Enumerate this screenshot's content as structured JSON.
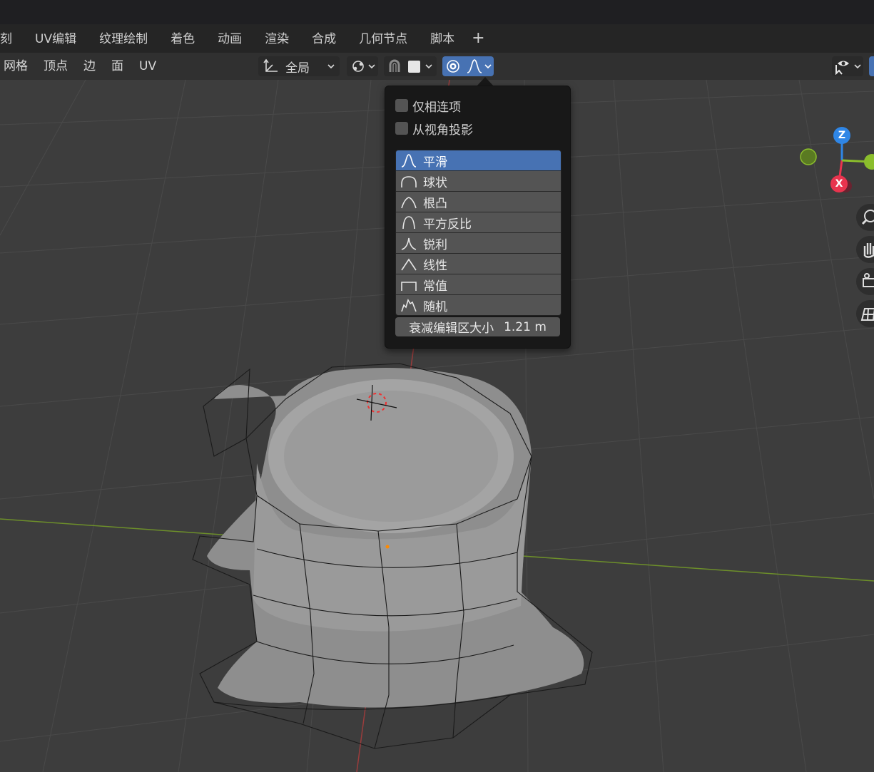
{
  "workspaces": {
    "tabs": [
      "刻",
      "UV编辑",
      "纹理绘制",
      "着色",
      "动画",
      "渲染",
      "合成",
      "几何节点",
      "脚本"
    ],
    "add_label": "+"
  },
  "header": {
    "menu": [
      "网格",
      "顶点",
      "边",
      "面",
      "UV"
    ],
    "transform_orientation": "全局"
  },
  "proportional_popup": {
    "connected_only_label": "仅相连项",
    "projected_label": "从视角投影",
    "falloff_options": [
      {
        "label": "平滑",
        "icon": "smooth-falloff-icon"
      },
      {
        "label": "球状",
        "icon": "sphere-falloff-icon"
      },
      {
        "label": "根凸",
        "icon": "root-falloff-icon"
      },
      {
        "label": "平方反比",
        "icon": "inverse-square-falloff-icon"
      },
      {
        "label": "锐利",
        "icon": "sharp-falloff-icon"
      },
      {
        "label": "线性",
        "icon": "linear-falloff-icon"
      },
      {
        "label": "常值",
        "icon": "constant-falloff-icon"
      },
      {
        "label": "随机",
        "icon": "random-falloff-icon"
      }
    ],
    "selected_falloff": "平滑",
    "size_label": "衰减编辑区大小",
    "size_value": "1.21 m"
  },
  "gizmo": {
    "z_label": "Z",
    "x_label": "X"
  },
  "colors": {
    "accent": "#4772b3",
    "x_axis": "#e8344e",
    "y_axis": "#8bbe2c",
    "z_axis": "#2f86e6"
  }
}
